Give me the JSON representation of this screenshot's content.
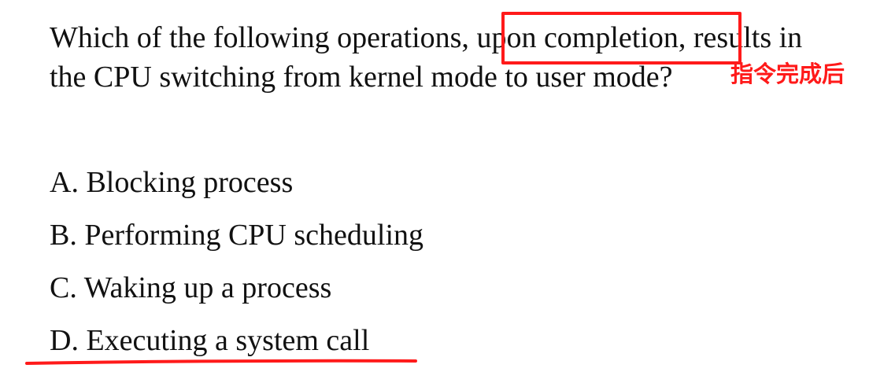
{
  "question": {
    "line1_before": "Which of the following operations,",
    "line1_highlight": "upon completion",
    "line1_after": ", results in",
    "line2": "the CPU switching from kernel mode to user mode?"
  },
  "options": [
    {
      "letter": "A.",
      "text": "Blocking process"
    },
    {
      "letter": "B.",
      "text": "Performing CPU scheduling"
    },
    {
      "letter": "C.",
      "text": "Waking up a process"
    },
    {
      "letter": "D.",
      "text": "Executing a system call"
    }
  ],
  "annotation": {
    "note": "指令完成后",
    "color": "#ff1a1a"
  }
}
